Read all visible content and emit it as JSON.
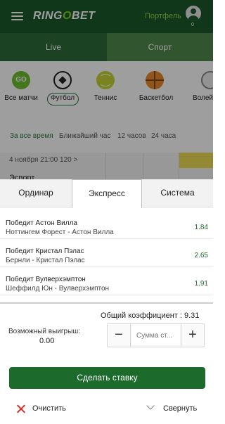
{
  "header": {
    "logo_left": "RING",
    "logo_accent": "O",
    "logo_right": "BET",
    "portfolio_label": "Портфель",
    "user_count": "0"
  },
  "top_tabs": [
    {
      "label": "Live"
    },
    {
      "label": "Спорт"
    }
  ],
  "sports": [
    {
      "label": "Все матчи",
      "icon": "go-icon",
      "icon_text": "GO"
    },
    {
      "label": "Футбол",
      "icon": "football-icon"
    },
    {
      "label": "Теннис",
      "icon": "tennis-ball-icon"
    },
    {
      "label": "Баскетбол",
      "icon": "basketball-icon"
    },
    {
      "label": "Волей",
      "icon": "volleyball-icon"
    }
  ],
  "time_filter": [
    {
      "label": "За все время",
      "active": true
    },
    {
      "label": "Ближайший час"
    },
    {
      "label": "12 часов"
    },
    {
      "label": "24 часа"
    }
  ],
  "event_strip": {
    "date": "4 ноября 21:00 120 >",
    "partial_text": "Эспорт"
  },
  "slip_tabs": [
    {
      "label": "Ординар"
    },
    {
      "label": "Экспресс",
      "active": true
    },
    {
      "label": "Система"
    }
  ],
  "bets": [
    {
      "title": "Победит Астон Вилла",
      "match": "Ноттингем Форест - Астон Вилла",
      "odd": "1.84"
    },
    {
      "title": "Победит Кристал Пэлас",
      "match": "Бернли - Кристал Пэлас",
      "odd": "2.65"
    },
    {
      "title": "Победит Вулверхэмптон",
      "match": "Шеффилд Юн - Вулверхэмптон",
      "odd": "1.91"
    }
  ],
  "summary": {
    "total_coef": "Общий коэффициент : 9.31",
    "possible_win_label": "Возможный выигрыш:",
    "possible_win_value": "0.00",
    "stake_placeholder": "Сумма ст...",
    "minus": "−",
    "plus": "+"
  },
  "actions": {
    "place_bet": "Сделать ставку",
    "clear": "Очистить",
    "collapse": "Свернуть"
  },
  "colors": {
    "brand_green": "#1c5a2b",
    "accent_green": "#7ed321",
    "button_green": "#1c6a2c",
    "clear_red": "#d62b2b"
  }
}
